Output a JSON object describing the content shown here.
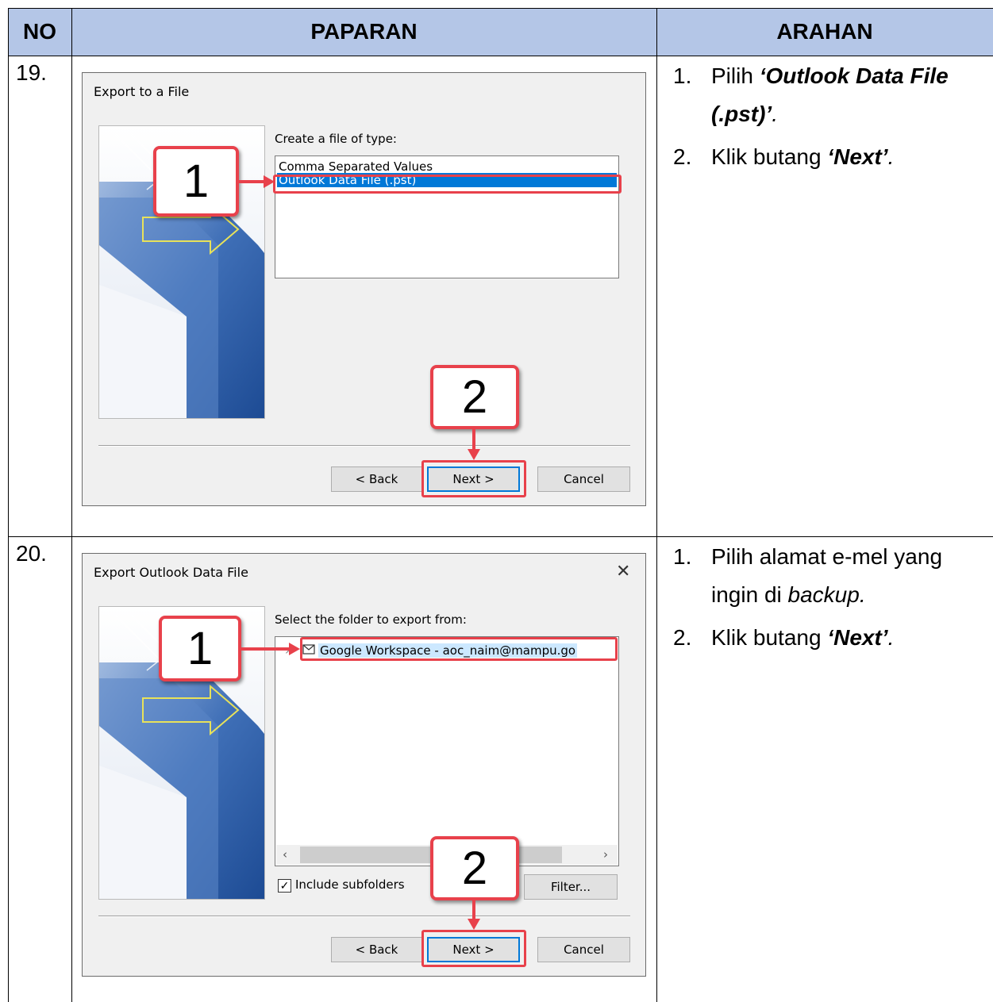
{
  "table": {
    "headers": {
      "no": "NO",
      "paparan": "PAPARAN",
      "arahan": "ARAHAN"
    },
    "colors": {
      "header_bg": "#b4c6e7",
      "callout_red": "#e8414b",
      "selection_blue": "#0078d7"
    },
    "rows": [
      {
        "no": "19.",
        "dialog": {
          "title": "Export to a File",
          "label": "Create a file of type:",
          "options": [
            "Comma Separated Values",
            "Outlook Data File (.pst)"
          ],
          "selected_option": "Outlook Data File (.pst)",
          "buttons": {
            "back": "< Back",
            "next": "Next >",
            "cancel": "Cancel"
          },
          "callout_1": "1",
          "callout_2": "2"
        },
        "instructions": [
          {
            "num": "1.",
            "pre": "Pilih ",
            "em": "‘Outlook Data File (.pst)’",
            "post": "."
          },
          {
            "num": "2.",
            "pre": "Klik butang ",
            "em": "‘Next’",
            "post": "."
          }
        ]
      },
      {
        "no": "20.",
        "dialog": {
          "title": "Export Outlook Data File",
          "close_icon": "close-icon",
          "label": "Select the folder to export from:",
          "tree_item": "Google Workspace - aoc_naim@mampu.go",
          "include_subfolders": "Include subfolders",
          "include_subfolders_checked": true,
          "filter_button": "Filter...",
          "buttons": {
            "back": "< Back",
            "next": "Next >",
            "cancel": "Cancel"
          },
          "callout_1": "1",
          "callout_2": "2"
        },
        "instructions": [
          {
            "num": "1.",
            "pre": "Pilih alamat e-mel yang ingin di ",
            "em": "backup",
            "post": "."
          },
          {
            "num": "2.",
            "pre": "Klik butang ",
            "em": "‘Next’",
            "post": "."
          }
        ]
      }
    ]
  }
}
